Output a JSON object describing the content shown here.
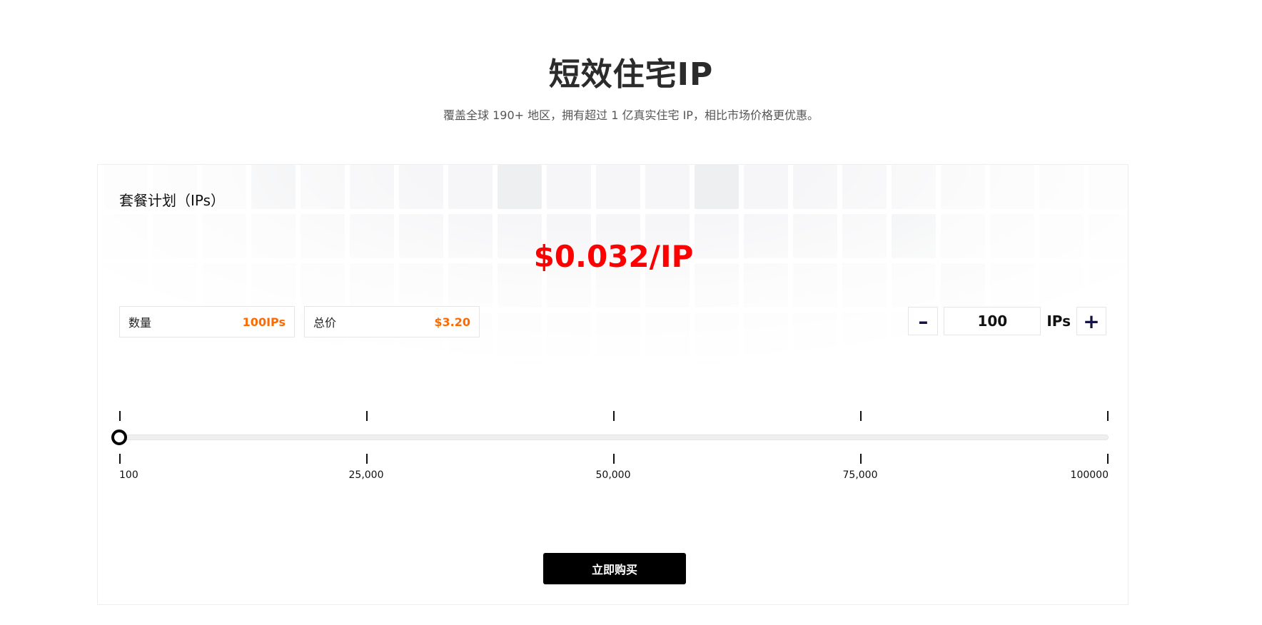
{
  "header": {
    "title": "短效住宅IP",
    "subtitle": "覆盖全球 190+ 地区，拥有超过 1 亿真实住宅 IP，相比市场价格更优惠。"
  },
  "plan": {
    "label": "套餐计划（IPs）",
    "price_per_ip": "$0.032/IP",
    "quantity_label": "数量",
    "quantity_value": "100IPs",
    "total_label": "总价",
    "total_value": "$3.20"
  },
  "stepper": {
    "minus_label": "–",
    "value": "100",
    "unit": "IPs",
    "plus_label": "+"
  },
  "slider": {
    "min": 100,
    "max": 100000,
    "value": 100,
    "tick_labels": [
      "100",
      "25,000",
      "50,000",
      "75,000",
      "100000"
    ]
  },
  "buy_button_label": "立即购买",
  "colors": {
    "price": "#ff0000",
    "accent": "#ff6a00",
    "button": "#000000"
  }
}
